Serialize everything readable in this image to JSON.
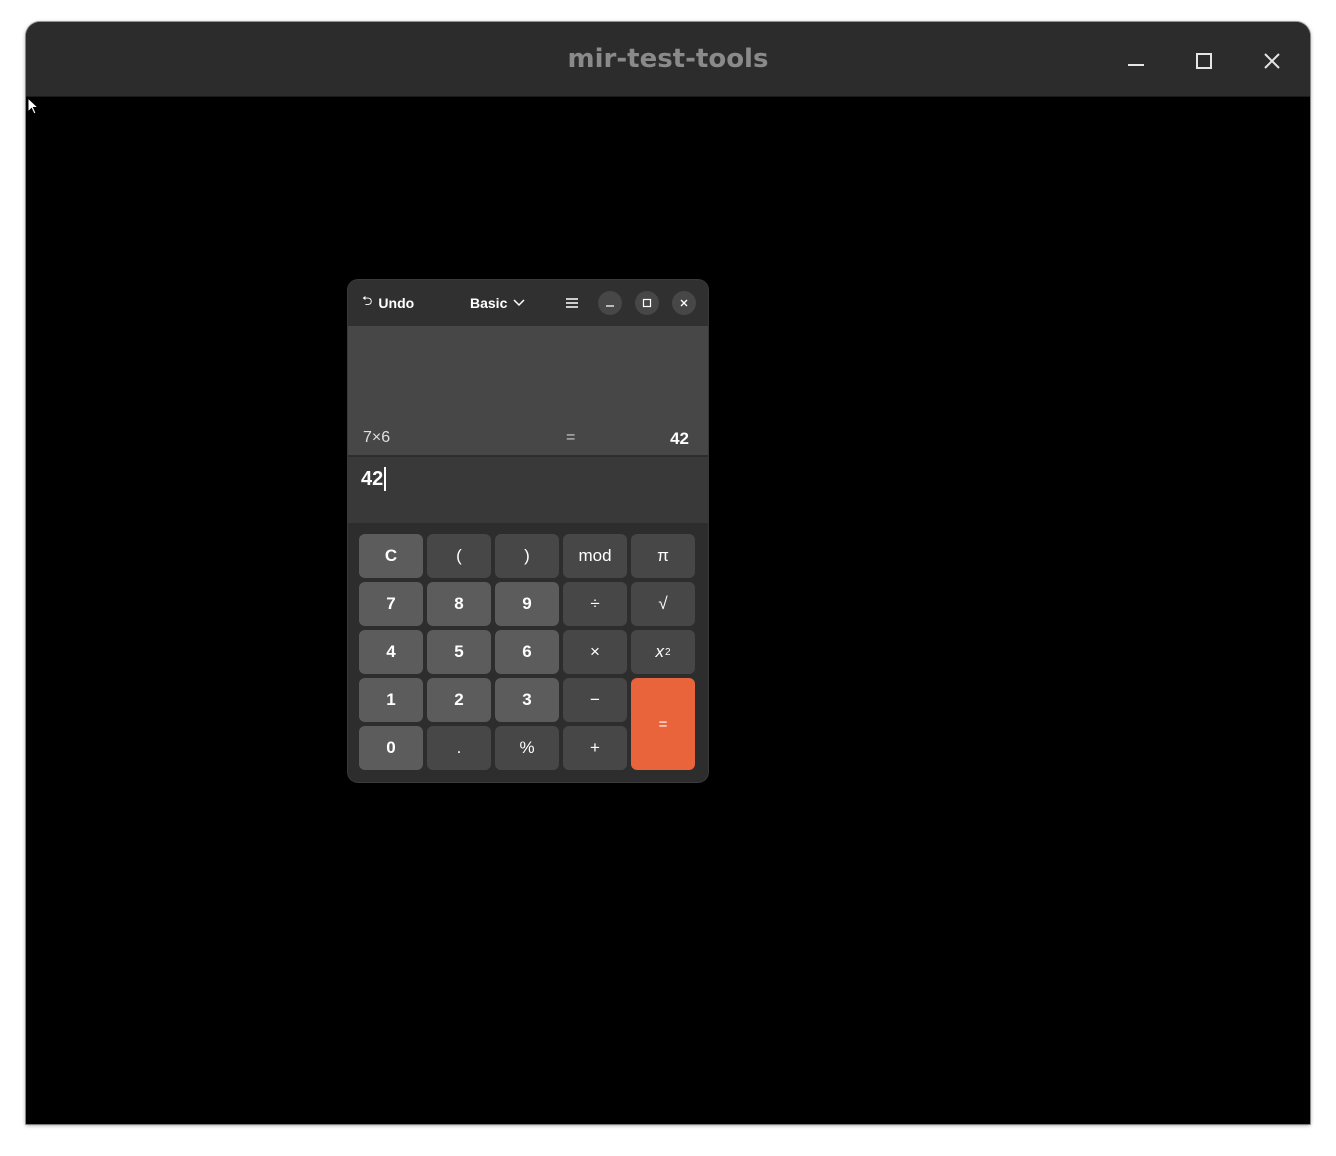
{
  "window": {
    "title": "mir-test-tools"
  },
  "calculator": {
    "header": {
      "undo_label": "Undo",
      "mode_label": "Basic"
    },
    "history": {
      "expression": "7×6",
      "equals": "=",
      "result": "42"
    },
    "entry": {
      "value": "42"
    },
    "keys": {
      "clear": "C",
      "open_paren": "(",
      "close_paren": ")",
      "mod": "mod",
      "pi": "π",
      "seven": "7",
      "eight": "8",
      "nine": "9",
      "divide": "÷",
      "sqrt": "√",
      "four": "4",
      "five": "5",
      "six": "6",
      "multiply": "×",
      "square_base": "x",
      "square_exp": "2",
      "one": "1",
      "two": "2",
      "three": "3",
      "minus": "−",
      "equals": "=",
      "zero": "0",
      "point": ".",
      "percent": "%",
      "plus": "+"
    },
    "colors": {
      "accent": "#e9643a",
      "number_key": "#5c5c5c",
      "operator_key": "#474747"
    }
  }
}
